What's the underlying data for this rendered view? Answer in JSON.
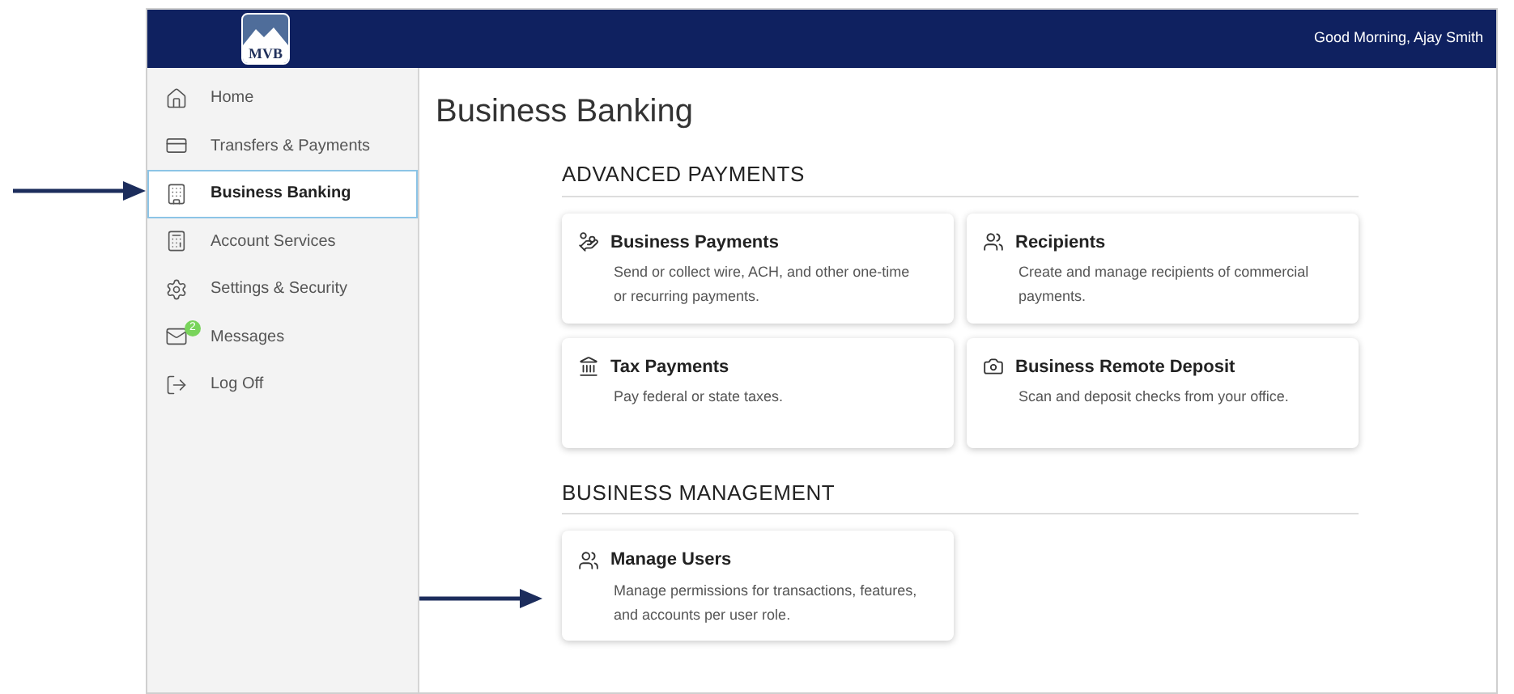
{
  "header": {
    "logo": "MVB",
    "greeting": "Good Morning, Ajay Smith"
  },
  "sidebar": {
    "items": [
      {
        "label": "Home",
        "selected": false
      },
      {
        "label": "Transfers & Payments",
        "selected": false
      },
      {
        "label": "Business Banking",
        "selected": true
      },
      {
        "label": "Account Services",
        "selected": false
      },
      {
        "label": "Settings & Security",
        "selected": false
      },
      {
        "label": "Messages",
        "selected": false,
        "badge": "2"
      },
      {
        "label": "Log Off",
        "selected": false
      }
    ]
  },
  "page_title": "Business Banking",
  "sections": [
    {
      "title": "ADVANCED PAYMENTS",
      "cards": [
        {
          "title": "Business Payments",
          "description": "Send or collect wire, ACH, and other one-time or recurring payments."
        },
        {
          "title": "Recipients",
          "description": "Create and manage recipients of commercial payments."
        },
        {
          "title": "Tax Payments",
          "description": "Pay federal or state taxes."
        },
        {
          "title": "Business Remote Deposit",
          "description": "Scan and deposit checks from your office."
        }
      ]
    },
    {
      "title": "BUSINESS MANAGEMENT",
      "cards": [
        {
          "title": "Manage Users",
          "description": "Manage permissions for transactions, features, and accounts per user role."
        }
      ]
    }
  ]
}
